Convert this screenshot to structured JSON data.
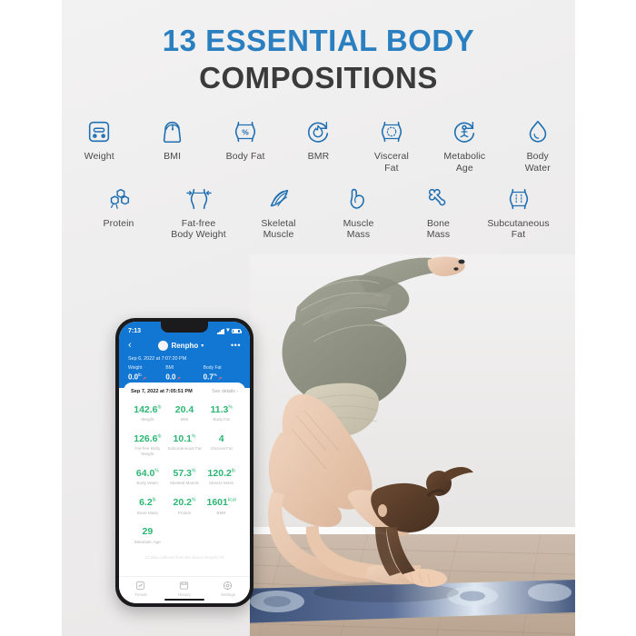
{
  "headline": {
    "line1": "13 ESSENTIAL BODY",
    "line2": "COMPOSITIONS",
    "accent_color": "#2a7fc1",
    "dark_color": "#3b3b3b"
  },
  "features": {
    "row1": [
      {
        "label": "Weight",
        "icon": "scale-icon"
      },
      {
        "label": "BMI",
        "icon": "bmi-scale-icon"
      },
      {
        "label": "Body Fat",
        "icon": "waist-percent-icon"
      },
      {
        "label": "BMR",
        "icon": "flame-refresh-icon"
      },
      {
        "label": "Visceral\nFat",
        "icon": "waist-dotted-icon"
      },
      {
        "label": "Metabolic\nAge",
        "icon": "person-refresh-icon"
      },
      {
        "label": "Body\nWater",
        "icon": "water-drop-icon"
      }
    ],
    "row2": [
      {
        "label": "Protein",
        "icon": "molecule-icon"
      },
      {
        "label": "Fat-free\nBody Weight",
        "icon": "waist-arrows-icon"
      },
      {
        "label": "Skeletal\nMuscle",
        "icon": "muscle-fiber-icon"
      },
      {
        "label": "Muscle\nMass",
        "icon": "biceps-icon"
      },
      {
        "label": "Bone\nMass",
        "icon": "bone-icon"
      },
      {
        "label": "Subcutaneous\nFat",
        "icon": "waist-dashed-icon"
      }
    ],
    "icon_color": "#1f6fb2"
  },
  "phone": {
    "statusbar": {
      "time": "7:13",
      "signal": "signal-bars-icon",
      "wifi": "wifi-icon",
      "battery": "battery-icon"
    },
    "navbar": {
      "back": "‹",
      "avatar": "user-avatar",
      "title": "Renpho",
      "caret": "▾",
      "menu": "•••"
    },
    "header_summary": {
      "date": "Sep 6, 2022 at 7:07:20 PM",
      "metrics": [
        {
          "label": "Weight",
          "value": "0.0",
          "unit": "lb",
          "trend": "↗"
        },
        {
          "label": "BMI",
          "value": "0.0",
          "unit": "",
          "trend": "↗"
        },
        {
          "label": "Body Fat",
          "value": "0.7",
          "unit": "%",
          "trend": "↗"
        }
      ]
    },
    "card": {
      "date": "Sep 7, 2022 at 7:05:51 PM",
      "see_details": "See details ›",
      "metrics": [
        {
          "value": "142.6",
          "unit": "lb",
          "label": "Weight"
        },
        {
          "value": "20.4",
          "unit": "",
          "label": "BMI"
        },
        {
          "value": "11.3",
          "unit": "%",
          "label": "Body Fat"
        },
        {
          "value": "126.6",
          "unit": "lb",
          "label": "Fat-free Body Weight"
        },
        {
          "value": "10.1",
          "unit": "%",
          "label": "Subcutaneous Fat"
        },
        {
          "value": "4",
          "unit": "",
          "label": "Visceral Fat"
        },
        {
          "value": "64.0",
          "unit": "%",
          "label": "Body Water"
        },
        {
          "value": "57.3",
          "unit": "%",
          "label": "Skeletal Muscle"
        },
        {
          "value": "120.2",
          "unit": "lb",
          "label": "Muscle Mass"
        },
        {
          "value": "6.2",
          "unit": "lb",
          "label": "Bone Mass"
        },
        {
          "value": "20.2",
          "unit": "%",
          "label": "Protein"
        },
        {
          "value": "1601",
          "unit": "kcal",
          "label": "BMR"
        },
        {
          "value": "29",
          "unit": "",
          "label": "Metabolic Age"
        }
      ],
      "note": "13 data collected from the device Renpho Fit",
      "value_color": "#2bb673"
    },
    "tabbar": [
      {
        "label": "Trends",
        "icon": "trends-icon"
      },
      {
        "label": "History",
        "icon": "history-icon"
      },
      {
        "label": "Settings",
        "icon": "settings-icon"
      }
    ],
    "header_color": "#1276d3"
  },
  "photo": {
    "subject": "woman-forearm-stand-yoga-pose",
    "wall_color": "#efeeee",
    "floor_color": "#c9b6a4",
    "mat_color": "#4a5f86",
    "outfit_top_color": "#cfc9b4",
    "outfit_legging_color": "#8e9080"
  }
}
